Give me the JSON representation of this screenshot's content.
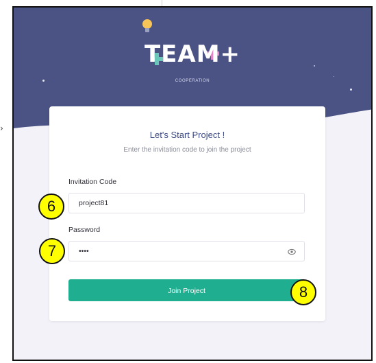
{
  "brand": {
    "name": "TEAM+",
    "tagline": "COOPERATION"
  },
  "card": {
    "title": "Let's Start Project !",
    "subtitle": "Enter the invitation code to join the project"
  },
  "invitation_code": {
    "label": "Invitation Code",
    "value": "project81"
  },
  "password": {
    "label": "Password",
    "value": "••••"
  },
  "join_button": {
    "label": "Join Project"
  },
  "step_markers": [
    "6",
    "7",
    "8"
  ],
  "margin_mark": "›",
  "colors": {
    "hero": "#4b5385",
    "accent": "#1fae8f",
    "title_text": "#3c4a82",
    "marker_fill": "#ffff00"
  },
  "icons": {
    "password_toggle": "eye-icon",
    "logo": "lightbulb-icon"
  }
}
